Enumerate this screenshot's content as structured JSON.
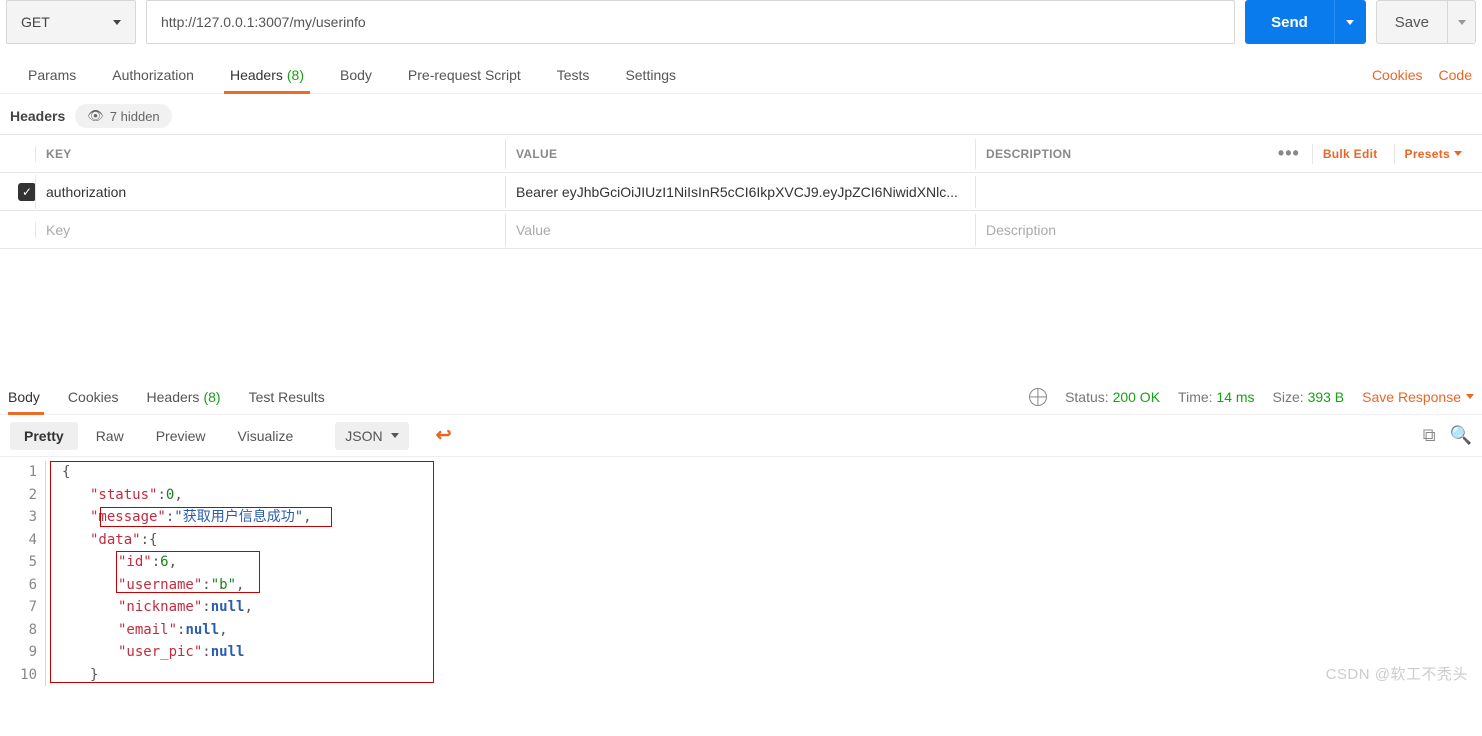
{
  "request": {
    "method": "GET",
    "url": "http://127.0.0.1:3007/my/userinfo",
    "send_label": "Send",
    "save_label": "Save"
  },
  "req_tabs": {
    "params": "Params",
    "authorization": "Authorization",
    "headers": "Headers",
    "headers_count": "(8)",
    "body": "Body",
    "prerequest": "Pre-request Script",
    "tests": "Tests",
    "settings": "Settings"
  },
  "cookies_link": "Cookies",
  "code_link": "Code",
  "section": {
    "title": "Headers",
    "hidden": "7 hidden"
  },
  "hdr_table": {
    "cols": {
      "key": "KEY",
      "value": "VALUE",
      "desc": "DESCRIPTION"
    },
    "bulk": "Bulk Edit",
    "presets": "Presets",
    "rows": [
      {
        "enabled": true,
        "key": "authorization",
        "value": "Bearer eyJhbGciOiJIUzI1NiIsInR5cCI6IkpXVCJ9.eyJpZCI6NiwidXNlc...",
        "desc": ""
      }
    ],
    "placeholders": {
      "key": "Key",
      "value": "Value",
      "desc": "Description"
    }
  },
  "resp_tabs": {
    "body": "Body",
    "cookies": "Cookies",
    "headers": "Headers",
    "headers_count": "(8)",
    "tests": "Test Results"
  },
  "status": {
    "status_label": "Status:",
    "status_value": "200 OK",
    "time_label": "Time:",
    "time_value": "14 ms",
    "size_label": "Size:",
    "size_value": "393 B",
    "save_response": "Save Response"
  },
  "view_tabs": {
    "pretty": "Pretty",
    "raw": "Raw",
    "preview": "Preview",
    "visualize": "Visualize",
    "json": "JSON"
  },
  "json_body": {
    "status_key": "\"status\"",
    "status_val": "0",
    "message_key": "\"message\"",
    "message_val": "\"获取用户信息成功\"",
    "data_key": "\"data\"",
    "id_key": "\"id\"",
    "id_val": "6",
    "username_key": "\"username\"",
    "username_val": "\"b\"",
    "nickname_key": "\"nickname\"",
    "email_key": "\"email\"",
    "userpic_key": "\"user_pic\"",
    "null_val": "null",
    "brace_open": "{",
    "brace_close": "}"
  },
  "watermark": "CSDN @软工不秃头"
}
